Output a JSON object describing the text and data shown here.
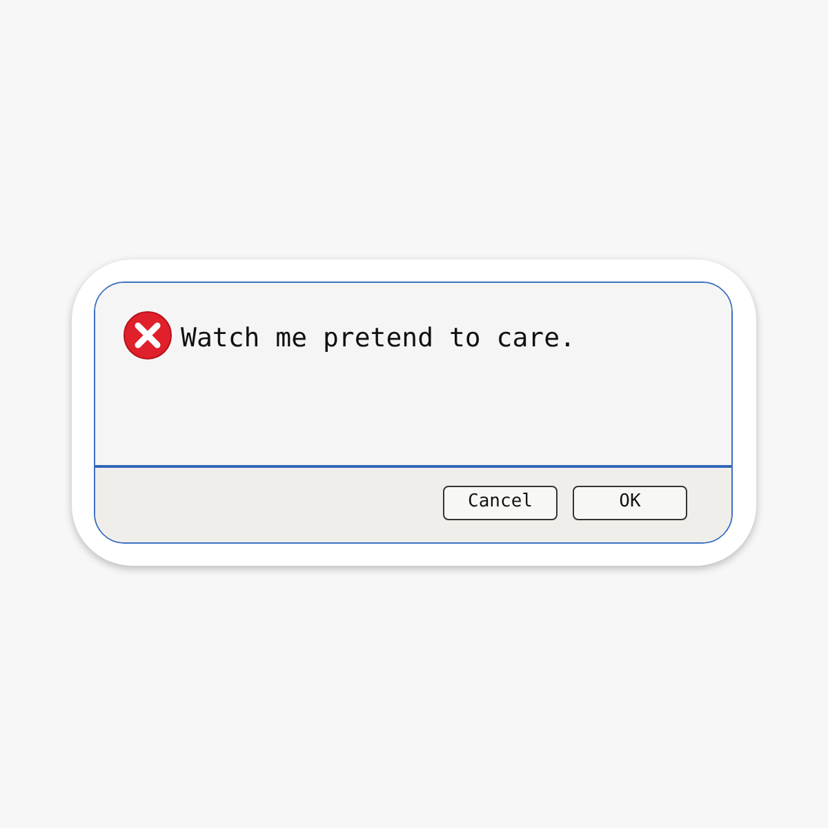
{
  "dialog": {
    "message": "Watch me pretend to care.",
    "buttons": [
      {
        "label": "Cancel"
      },
      {
        "label": "OK"
      }
    ]
  }
}
